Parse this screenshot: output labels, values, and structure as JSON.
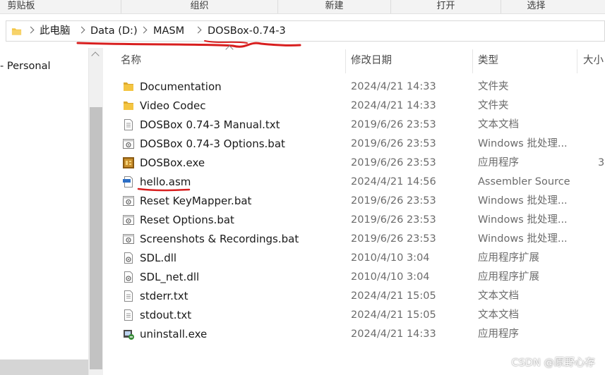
{
  "ribbon": {
    "groups": [
      "剪贴板",
      "组织",
      "新建",
      "打开",
      "选择"
    ]
  },
  "address": {
    "breadcrumbs": [
      "此电脑",
      "Data (D:)",
      "MASM",
      "DOSBox-0.74-3"
    ]
  },
  "nav": {
    "item_label": "- Personal"
  },
  "columns": {
    "name": "名称",
    "date": "修改日期",
    "type": "类型",
    "size": "大小"
  },
  "files": [
    {
      "name": "Documentation",
      "date": "2024/4/21 14:33",
      "type": "文件夹",
      "size": "",
      "icon": "folder-icon"
    },
    {
      "name": "Video Codec",
      "date": "2024/4/21 14:33",
      "type": "文件夹",
      "size": "",
      "icon": "folder-icon"
    },
    {
      "name": "DOSBox 0.74-3 Manual.txt",
      "date": "2019/6/26 23:53",
      "type": "文本文档",
      "size": "",
      "icon": "text-file-icon"
    },
    {
      "name": "DOSBox 0.74-3 Options.bat",
      "date": "2019/6/26 23:53",
      "type": "Windows 批处理...",
      "size": "",
      "icon": "batch-file-icon"
    },
    {
      "name": "DOSBox.exe",
      "date": "2019/6/26 23:53",
      "type": "应用程序",
      "size": "3",
      "icon": "dosbox-app-icon"
    },
    {
      "name": "hello.asm",
      "date": "2024/4/21 14:56",
      "type": "Assembler Source",
      "size": "",
      "icon": "asm-file-icon"
    },
    {
      "name": "Reset KeyMapper.bat",
      "date": "2019/6/26 23:53",
      "type": "Windows 批处理...",
      "size": "",
      "icon": "batch-file-icon"
    },
    {
      "name": "Reset Options.bat",
      "date": "2019/6/26 23:53",
      "type": "Windows 批处理...",
      "size": "",
      "icon": "batch-file-icon"
    },
    {
      "name": "Screenshots & Recordings.bat",
      "date": "2019/6/26 23:53",
      "type": "Windows 批处理...",
      "size": "",
      "icon": "batch-file-icon"
    },
    {
      "name": "SDL.dll",
      "date": "2010/4/10 3:04",
      "type": "应用程序扩展",
      "size": "",
      "icon": "dll-file-icon"
    },
    {
      "name": "SDL_net.dll",
      "date": "2010/4/10 3:04",
      "type": "应用程序扩展",
      "size": "",
      "icon": "dll-file-icon"
    },
    {
      "name": "stderr.txt",
      "date": "2024/4/21 15:05",
      "type": "文本文档",
      "size": "",
      "icon": "text-file-icon"
    },
    {
      "name": "stdout.txt",
      "date": "2024/4/21 15:05",
      "type": "文本文档",
      "size": "",
      "icon": "text-file-icon"
    },
    {
      "name": "uninstall.exe",
      "date": "2024/4/21 14:33",
      "type": "应用程序",
      "size": "",
      "icon": "uninstall-app-icon"
    }
  ],
  "watermark": "CSDN @原野心存",
  "colors": {
    "folder": "#f4c542",
    "annotation": "#d81e1e",
    "selection": "#d5d5d5"
  }
}
